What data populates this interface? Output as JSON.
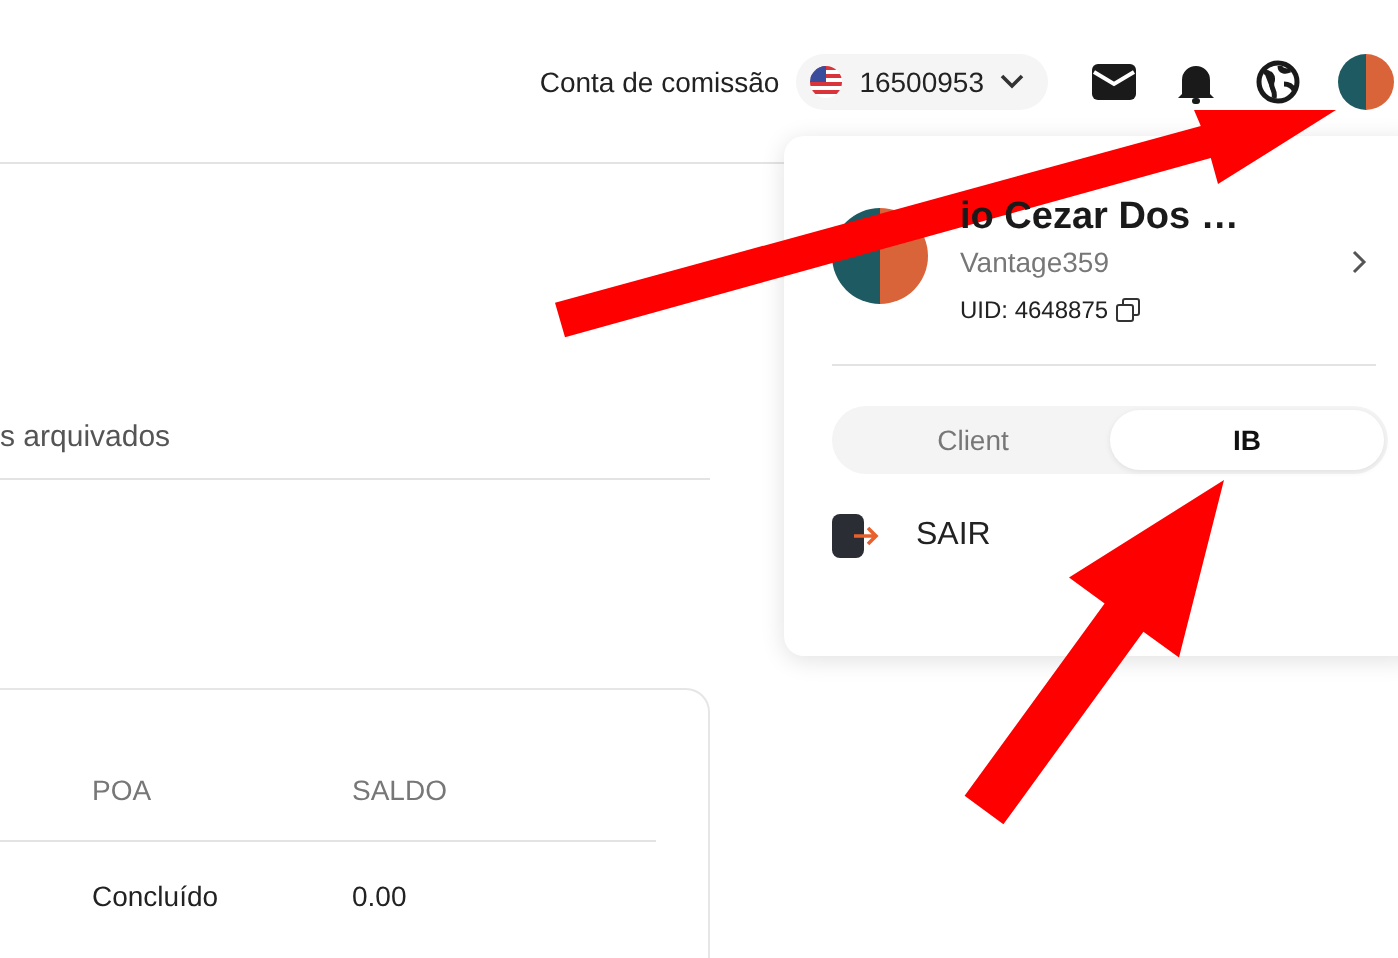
{
  "header": {
    "account_label": "Conta de comissão",
    "account_number": "16500953"
  },
  "tabs": [
    {
      "label": "s arquivados"
    }
  ],
  "table": {
    "columns": [
      "POA",
      "SALDO"
    ],
    "rows": [
      [
        "Concluído",
        "0.00"
      ]
    ]
  },
  "profile_menu": {
    "name": "io Cezar Dos …",
    "username": "Vantage359",
    "uid": "UID: 4648875",
    "modes": [
      {
        "label": "Client",
        "selected": false
      },
      {
        "label": "IB",
        "selected": true
      }
    ],
    "logout": "SAIR"
  }
}
